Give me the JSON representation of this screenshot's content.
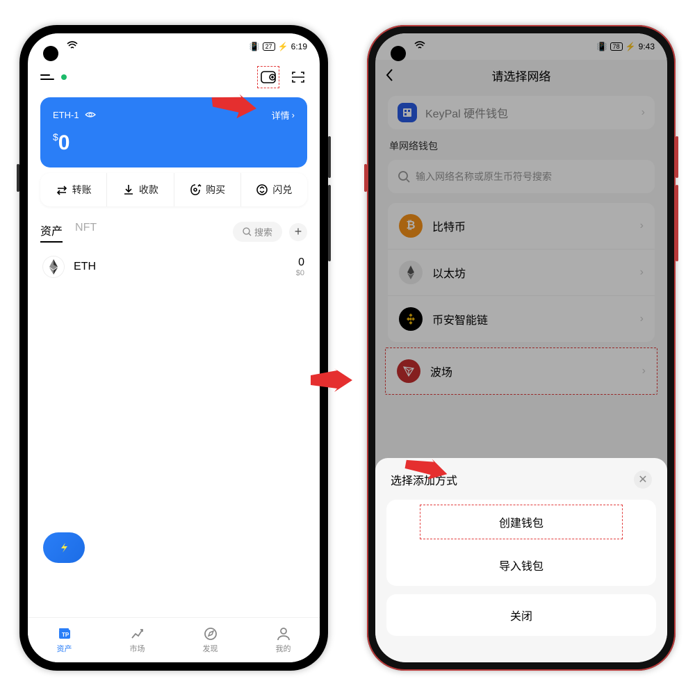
{
  "phone1": {
    "status": {
      "time": "6:19",
      "battery": "27"
    },
    "wallet": {
      "name": "ETH-1",
      "detailLabel": "详情",
      "balance": "0",
      "currency": "$"
    },
    "actions": {
      "transfer": "转账",
      "receive": "收款",
      "buy": "购买",
      "swap": "闪兑"
    },
    "tabs": {
      "assets": "资产",
      "nft": "NFT"
    },
    "searchPlaceholder": "搜索",
    "token": {
      "symbol": "ETH",
      "amount": "0",
      "fiat": "$0"
    },
    "nav": {
      "assets": "资产",
      "market": "市场",
      "discover": "发现",
      "me": "我的"
    }
  },
  "phone2": {
    "status": {
      "time": "9:43",
      "battery": "78"
    },
    "headerTitle": "请选择网络",
    "keypalRow": "KeyPal 硬件钱包",
    "section": "单网络钱包",
    "searchPlaceholder": "输入网络名称或原生币符号搜索",
    "networks": {
      "btc": "比特币",
      "eth": "以太坊",
      "bsc": "币安智能链",
      "tron": "波场"
    },
    "sheet": {
      "title": "选择添加方式",
      "create": "创建钱包",
      "import": "导入钱包",
      "close": "关闭"
    }
  }
}
